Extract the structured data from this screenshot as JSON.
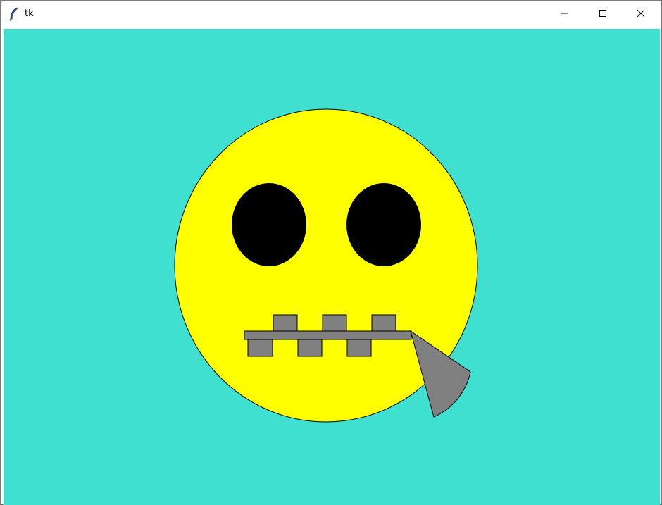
{
  "window": {
    "title": "tk",
    "controls": {
      "minimize_icon": "minimize-icon",
      "maximize_icon": "maximize-icon",
      "close_icon": "close-icon"
    }
  },
  "canvas": {
    "background": "#40E0D0",
    "face_color": "#FFFF00",
    "eye_color": "#000000",
    "zipper_color": "#808080",
    "outline_color": "#000000"
  }
}
